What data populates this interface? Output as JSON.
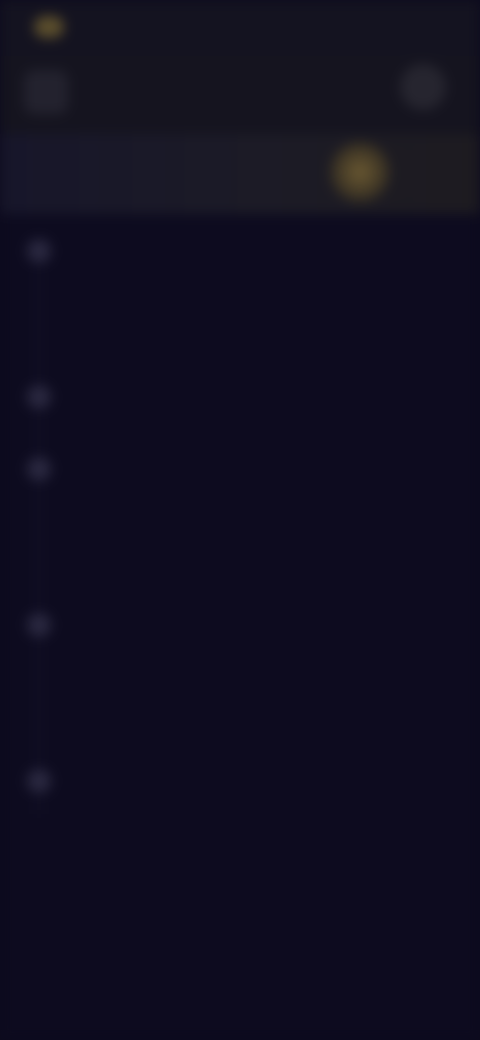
{
  "status_bar": {
    "time": ""
  },
  "header": {
    "title": "",
    "back_icon": "chevron-left-icon",
    "more_icon": "more-icon"
  },
  "points": {
    "label": "",
    "coin_icon": "coin-icon"
  },
  "timeline": {
    "items": [
      {
        "title": "",
        "description": ""
      },
      {
        "title": "",
        "description": ""
      },
      {
        "title": "",
        "description": ""
      },
      {
        "title": "",
        "description": ""
      },
      {
        "title": "",
        "description": ""
      }
    ]
  },
  "colors": {
    "background": "#0c0a1d",
    "header": "#15141f",
    "accent_gold": "#6c5a32"
  }
}
